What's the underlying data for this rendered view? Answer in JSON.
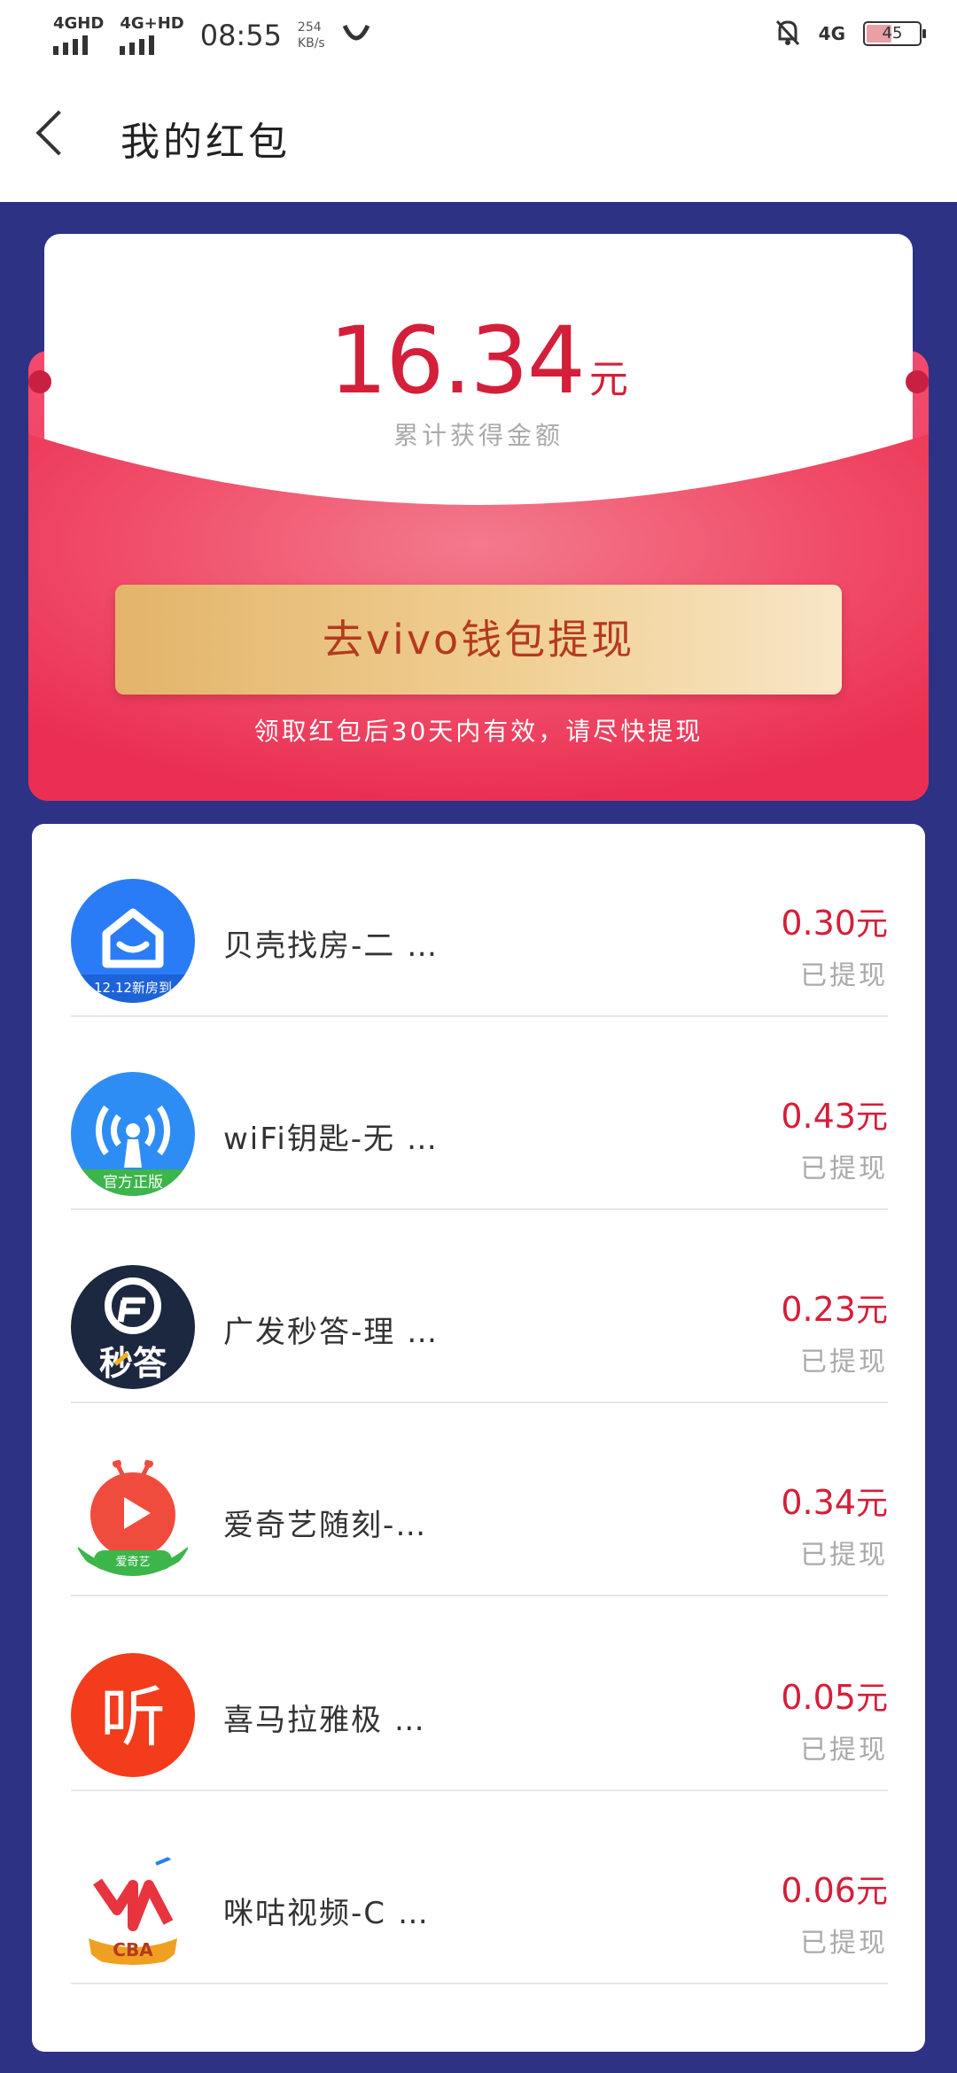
{
  "status_bar": {
    "sim1": "4GHD",
    "sim2": "4G+HD",
    "time": "08:55",
    "speed_value": "254",
    "speed_unit": "KB/s",
    "network": "4G",
    "battery": "45"
  },
  "header": {
    "title": "我的红包"
  },
  "summary": {
    "amount": "16.34",
    "unit": "元",
    "label": "累计获得金额",
    "withdraw_button": "去vivo钱包提现",
    "tip": "领取红包后30天内有效，请尽快提现"
  },
  "items": [
    {
      "name": "贝壳找房-二 …",
      "amount": "0.30",
      "unit": "元",
      "status": "已提现",
      "icon": "beike-icon",
      "icon_caption": "12.12新房到",
      "color": "#2a7cf6"
    },
    {
      "name": "wiFi钥匙-无 …",
      "amount": "0.43",
      "unit": "元",
      "status": "已提现",
      "icon": "wifi-key-icon",
      "icon_caption": "官方正版",
      "color": "#2e8df5"
    },
    {
      "name": "广发秒答-理 …",
      "amount": "0.23",
      "unit": "元",
      "status": "已提现",
      "icon": "guangfa-icon",
      "icon_caption": "秒答",
      "color": "#1c2740"
    },
    {
      "name": "爱奇艺随刻-…",
      "amount": "0.34",
      "unit": "元",
      "status": "已提现",
      "icon": "iqiyi-suike-icon",
      "icon_caption": "爱奇艺",
      "color": "#f04c3e"
    },
    {
      "name": "喜马拉雅极 …",
      "amount": "0.05",
      "unit": "元",
      "status": "已提现",
      "icon": "ximalaya-icon",
      "icon_caption": "听",
      "color": "#f23c1c"
    },
    {
      "name": "咪咕视频-C …",
      "amount": "0.06",
      "unit": "元",
      "status": "已提现",
      "icon": "migu-video-icon",
      "icon_caption": "CBA",
      "color": "#e8343f"
    }
  ]
}
